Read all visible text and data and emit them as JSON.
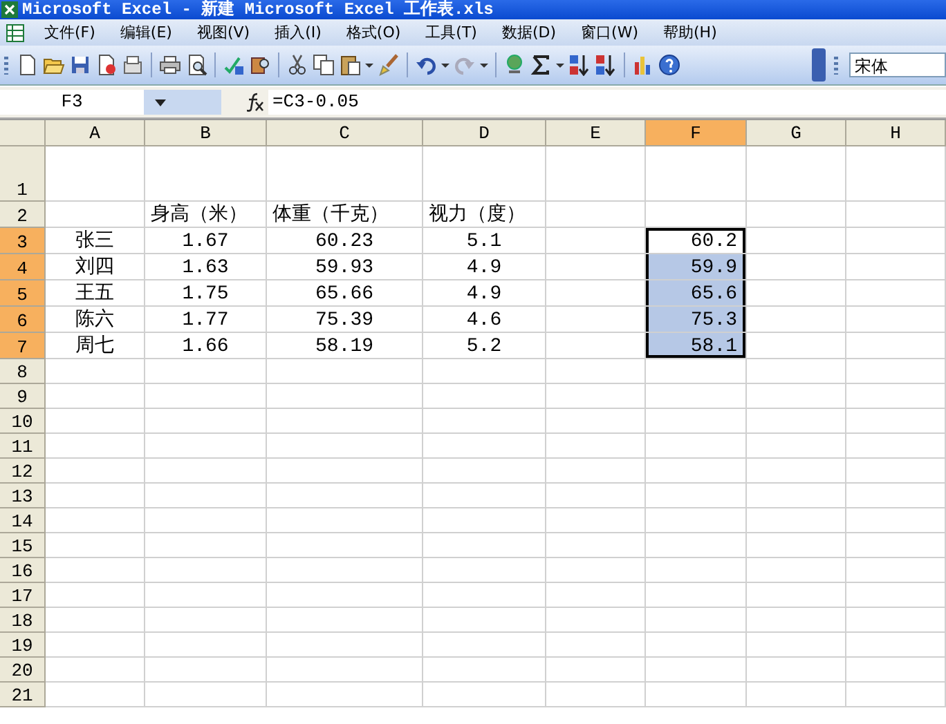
{
  "window": {
    "title": "Microsoft Excel - 新建 Microsoft Excel 工作表.xls"
  },
  "menu": [
    "文件(F)",
    "编辑(E)",
    "视图(V)",
    "插入(I)",
    "格式(O)",
    "工具(T)",
    "数据(D)",
    "窗口(W)",
    "帮助(H)"
  ],
  "toolbar": {
    "font_box": "宋体"
  },
  "formula_bar": {
    "name_box": "F3",
    "formula": "=C3-0.05"
  },
  "sheet": {
    "columns": [
      {
        "label": "A",
        "selected": false
      },
      {
        "label": "B",
        "selected": false
      },
      {
        "label": "C",
        "selected": false
      },
      {
        "label": "D",
        "selected": false
      },
      {
        "label": "E",
        "selected": false
      },
      {
        "label": "F",
        "selected": true
      },
      {
        "label": "G",
        "selected": false
      },
      {
        "label": "H",
        "selected": false
      }
    ],
    "rows": [
      {
        "label": "1",
        "selected": false,
        "kind": "data",
        "cells": []
      },
      {
        "label": "2",
        "selected": false,
        "kind": "heading",
        "cells": [
          {
            "text": "",
            "selected": false
          },
          {
            "text": "身高（米）",
            "selected": false
          },
          {
            "text": "体重（千克）",
            "selected": false
          },
          {
            "text": "视力（度）",
            "selected": false
          },
          {
            "text": "",
            "selected": false
          },
          {
            "text": "",
            "selected": false
          },
          {
            "text": "",
            "selected": false
          },
          {
            "text": "",
            "selected": false
          }
        ]
      },
      {
        "label": "3",
        "selected": true,
        "kind": "data",
        "cells": [
          {
            "text": "张三",
            "selected": false
          },
          {
            "text": "1.67",
            "selected": false
          },
          {
            "text": "60.23",
            "selected": false
          },
          {
            "text": "5.1",
            "selected": false
          },
          {
            "text": "",
            "selected": false
          },
          {
            "text": "60.2",
            "selected": true
          },
          {
            "text": "",
            "selected": false
          },
          {
            "text": "",
            "selected": false
          }
        ]
      },
      {
        "label": "4",
        "selected": true,
        "kind": "data",
        "cells": [
          {
            "text": "刘四",
            "selected": false
          },
          {
            "text": "1.63",
            "selected": false
          },
          {
            "text": "59.93",
            "selected": false
          },
          {
            "text": "4.9",
            "selected": false
          },
          {
            "text": "",
            "selected": false
          },
          {
            "text": "59.9",
            "selected": true
          },
          {
            "text": "",
            "selected": false
          },
          {
            "text": "",
            "selected": false
          }
        ]
      },
      {
        "label": "5",
        "selected": true,
        "kind": "data",
        "cells": [
          {
            "text": "王五",
            "selected": false
          },
          {
            "text": "1.75",
            "selected": false
          },
          {
            "text": "65.66",
            "selected": false
          },
          {
            "text": "4.9",
            "selected": false
          },
          {
            "text": "",
            "selected": false
          },
          {
            "text": "65.6",
            "selected": true
          },
          {
            "text": "",
            "selected": false
          },
          {
            "text": "",
            "selected": false
          }
        ]
      },
      {
        "label": "6",
        "selected": true,
        "kind": "data",
        "cells": [
          {
            "text": "陈六",
            "selected": false
          },
          {
            "text": "1.77",
            "selected": false
          },
          {
            "text": "75.39",
            "selected": false
          },
          {
            "text": "4.6",
            "selected": false
          },
          {
            "text": "",
            "selected": false
          },
          {
            "text": "75.3",
            "selected": true
          },
          {
            "text": "",
            "selected": false
          },
          {
            "text": "",
            "selected": false
          }
        ]
      },
      {
        "label": "7",
        "selected": true,
        "kind": "data",
        "cells": [
          {
            "text": "周七",
            "selected": false
          },
          {
            "text": "1.66",
            "selected": false
          },
          {
            "text": "58.19",
            "selected": false
          },
          {
            "text": "5.2",
            "selected": false
          },
          {
            "text": "",
            "selected": false
          },
          {
            "text": "58.1",
            "selected": true
          },
          {
            "text": "",
            "selected": false
          },
          {
            "text": "",
            "selected": false
          }
        ]
      },
      {
        "label": "8",
        "selected": false,
        "kind": "data",
        "cells": []
      },
      {
        "label": "9",
        "selected": false,
        "kind": "data",
        "cells": []
      },
      {
        "label": "10",
        "selected": false,
        "kind": "data",
        "cells": []
      },
      {
        "label": "11",
        "selected": false,
        "kind": "data",
        "cells": []
      },
      {
        "label": "12",
        "selected": false,
        "kind": "data",
        "cells": []
      },
      {
        "label": "13",
        "selected": false,
        "kind": "data",
        "cells": []
      },
      {
        "label": "14",
        "selected": false,
        "kind": "data",
        "cells": []
      },
      {
        "label": "15",
        "selected": false,
        "kind": "data",
        "cells": []
      },
      {
        "label": "16",
        "selected": false,
        "kind": "data",
        "cells": []
      },
      {
        "label": "17",
        "selected": false,
        "kind": "data",
        "cells": []
      },
      {
        "label": "18",
        "selected": false,
        "kind": "data",
        "cells": []
      },
      {
        "label": "19",
        "selected": false,
        "kind": "data",
        "cells": []
      },
      {
        "label": "20",
        "selected": false,
        "kind": "data",
        "cells": []
      },
      {
        "label": "21",
        "selected": false,
        "kind": "data",
        "cells": []
      }
    ]
  }
}
